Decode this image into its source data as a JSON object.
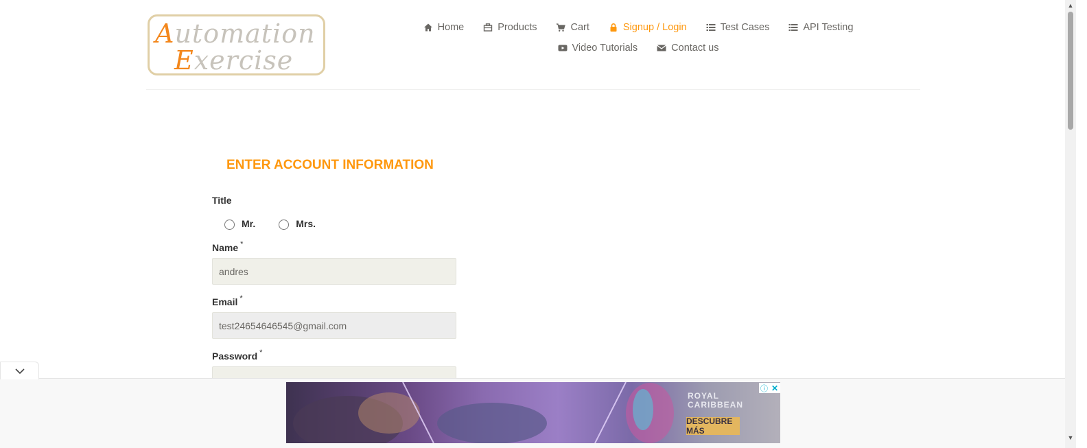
{
  "logo": {
    "line1_cap": "A",
    "line1_rest": "utomation",
    "line2_cap": "E",
    "line2_rest": "xercise"
  },
  "nav": {
    "row1": [
      {
        "label": "Home",
        "icon": "home-icon"
      },
      {
        "label": "Products",
        "icon": "products-icon"
      },
      {
        "label": "Cart",
        "icon": "cart-icon"
      },
      {
        "label": "Signup / Login",
        "icon": "lock-icon",
        "active": true
      },
      {
        "label": "Test Cases",
        "icon": "list-icon"
      },
      {
        "label": "API Testing",
        "icon": "list-icon"
      }
    ],
    "row2": [
      {
        "label": "Video Tutorials",
        "icon": "youtube-icon"
      },
      {
        "label": "Contact us",
        "icon": "envelope-icon"
      }
    ]
  },
  "form": {
    "title": "ENTER ACCOUNT INFORMATION",
    "title_label": "Title",
    "title_options": [
      "Mr.",
      "Mrs."
    ],
    "name_label": "Name",
    "name_value": "andres",
    "email_label": "Email",
    "email_value": "test24654646545@gmail.com",
    "password_label": "Password",
    "password_value": "",
    "required_mark": "*"
  },
  "ad": {
    "brand_line1": "ROYAL",
    "brand_line2": "CARIBBEAN",
    "cta": "DESCUBRE MÁS",
    "info_icon": "info-icon",
    "close_icon": "close-icon"
  },
  "colors": {
    "accent": "#fe980f",
    "text": "#696763",
    "input_bg": "#f0f0e9"
  }
}
